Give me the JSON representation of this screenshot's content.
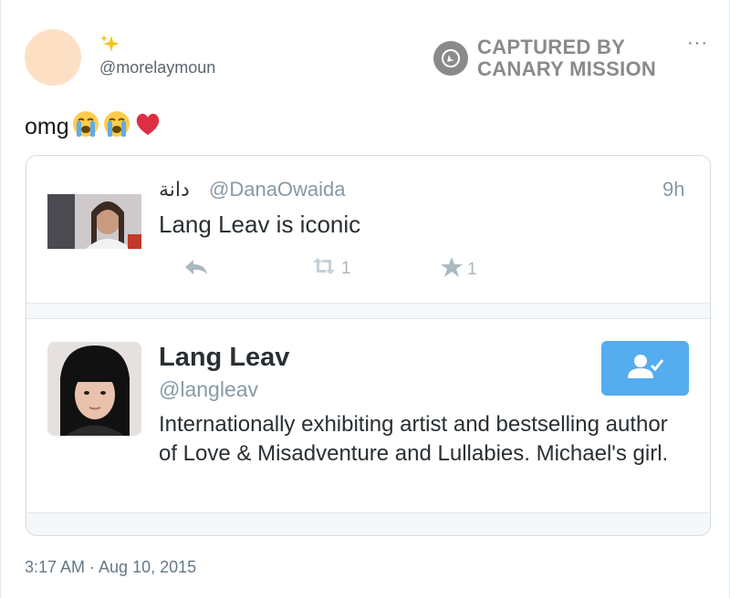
{
  "tweet": {
    "emoji_name": "✨",
    "handle": "@morelaymoun",
    "text": "omg",
    "emojis": [
      "😭",
      "😭",
      "❤️"
    ],
    "timestamp": "3:17 AM · Aug 10, 2015"
  },
  "watermark": {
    "line1": "CAPTURED BY",
    "line2": "CANARY MISSION"
  },
  "more_menu": "···",
  "quoted": {
    "name": "دانة",
    "handle": "@DanaOwaida",
    "time": "9h",
    "text": "Lang Leav is iconic",
    "retweets": "1",
    "favorites": "1"
  },
  "user_card": {
    "name": "Lang Leav",
    "handle": "@langleav",
    "bio": "Internationally exhibiting artist and bestselling author of Love & Misadventure and Lullabies. Michael's girl."
  },
  "colors": {
    "accent": "#55acee",
    "muted": "#8899a6",
    "watermark": "#8a8a8a"
  }
}
